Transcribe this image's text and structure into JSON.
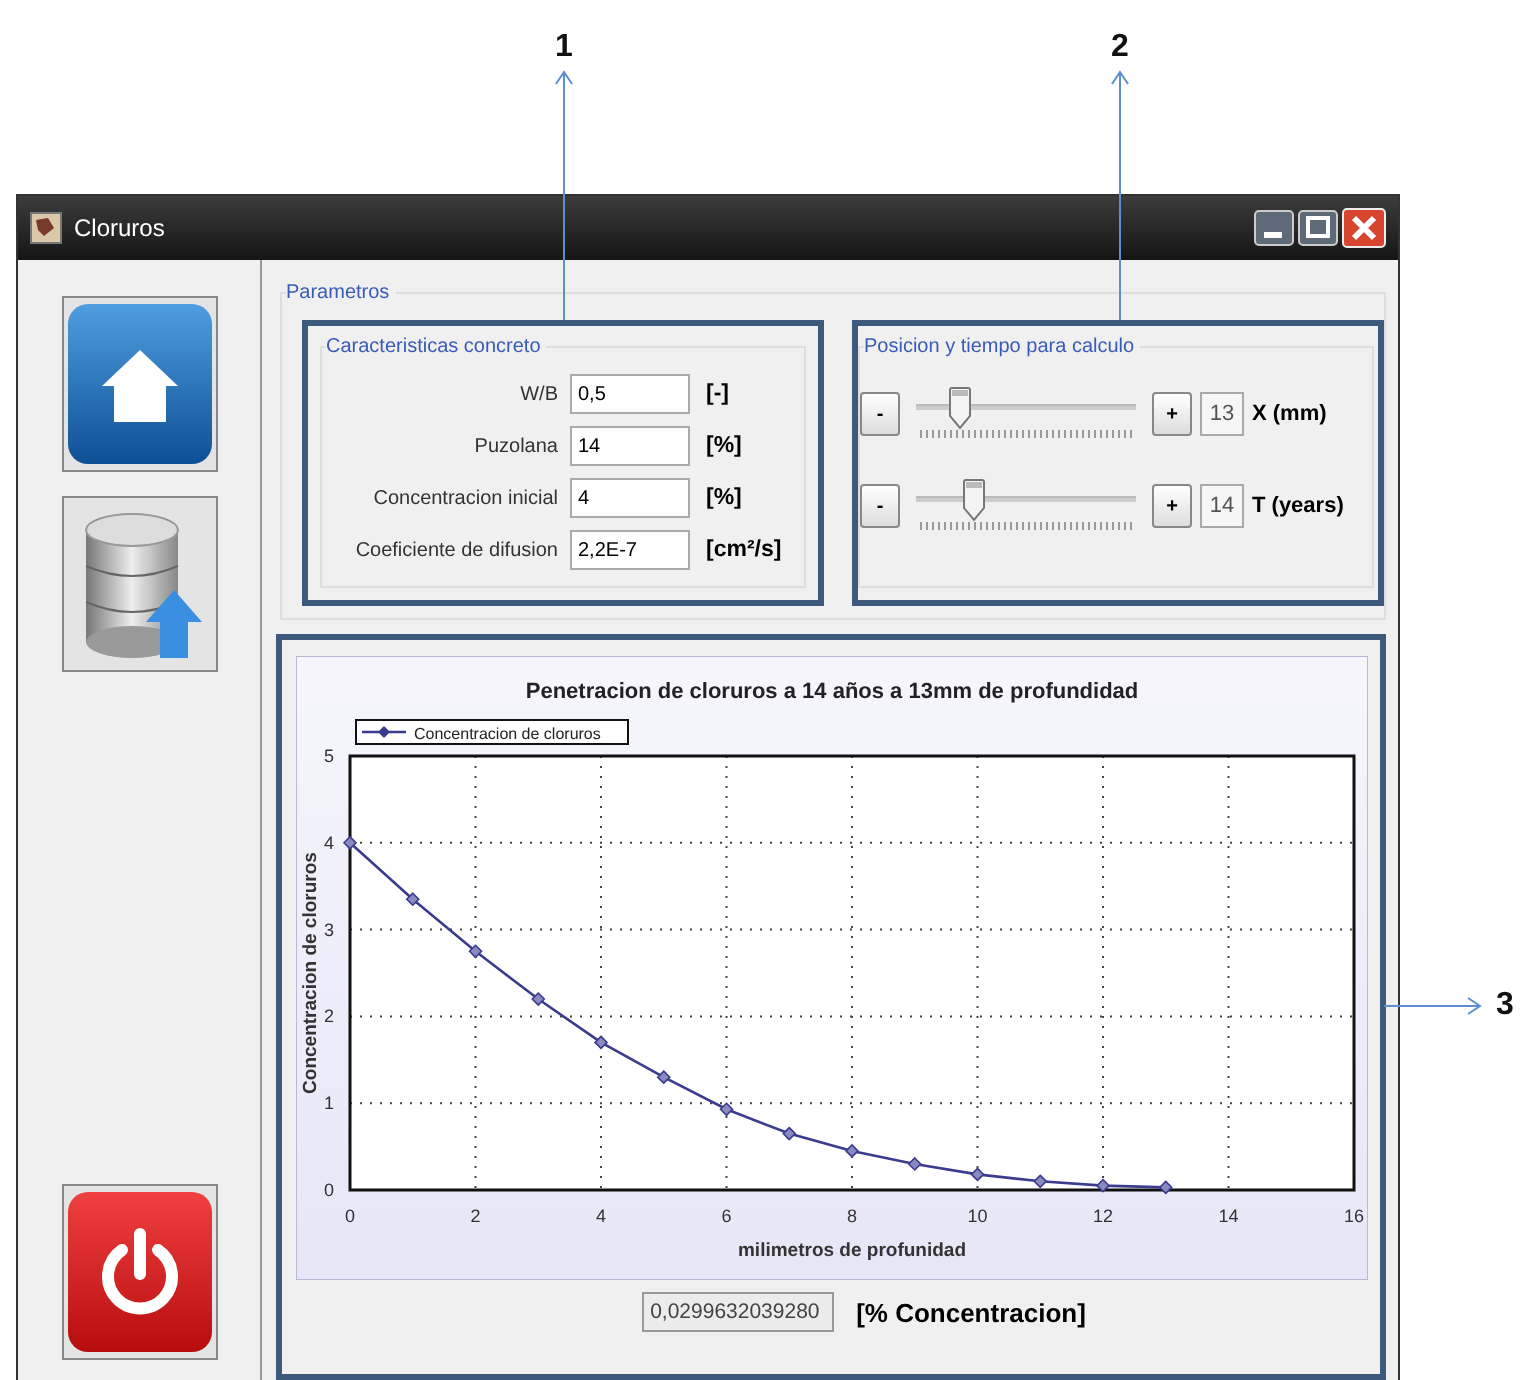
{
  "callouts": [
    {
      "label": "1",
      "kind": "down"
    },
    {
      "label": "2",
      "kind": "down"
    },
    {
      "label": "3",
      "kind": "right"
    }
  ],
  "window": {
    "title": "Cloruros"
  },
  "parameters": {
    "title": "Parametros",
    "concrete": {
      "title": "Caracteristicas concreto",
      "rows": [
        {
          "label": "W/B",
          "value": "0,5",
          "unit": "[-]"
        },
        {
          "label": "Puzolana",
          "value": "14",
          "unit": "[%]"
        },
        {
          "label": "Concentracion inicial",
          "value": "4",
          "unit": "[%]"
        },
        {
          "label": "Coeficiente de difusion",
          "value": "2,2E-7",
          "unit": "[cm²/s]"
        }
      ]
    },
    "position": {
      "title": "Posicion y tiempo para calculo",
      "sliders": [
        {
          "minus": "-",
          "plus": "+",
          "value": "13",
          "unit": "X (mm)",
          "level": 0.22
        },
        {
          "minus": "-",
          "plus": "+",
          "value": "14",
          "unit": "T (years)",
          "level": 0.28
        }
      ]
    }
  },
  "chart": {
    "chart_data": {
      "type": "line",
      "title": "Penetracion de cloruros a 14 años a 13mm de profundidad",
      "xlabel": "milimetros de profunidad",
      "ylabel": "Concentracion de cloruros",
      "x": [
        0,
        1,
        2,
        3,
        4,
        5,
        6,
        7,
        8,
        9,
        10,
        11,
        12,
        13
      ],
      "series": [
        {
          "name": "Concentracion de cloruros",
          "color": "#3b3b8f",
          "marker": "diamond",
          "values": [
            4,
            3.35,
            2.75,
            2.2,
            1.7,
            1.3,
            0.93,
            0.65,
            0.45,
            0.3,
            0.18,
            0.1,
            0.05,
            0.03
          ]
        }
      ],
      "xlim": [
        0,
        16
      ],
      "ylim": [
        0,
        5
      ],
      "xticks": [
        0,
        2,
        4,
        6,
        8,
        10,
        12,
        14,
        16
      ],
      "yticks": [
        0,
        1,
        2,
        3,
        4,
        5
      ],
      "grid": true
    },
    "result": {
      "value": "0,0299632039280",
      "unit": "[% Concentracion]"
    }
  }
}
